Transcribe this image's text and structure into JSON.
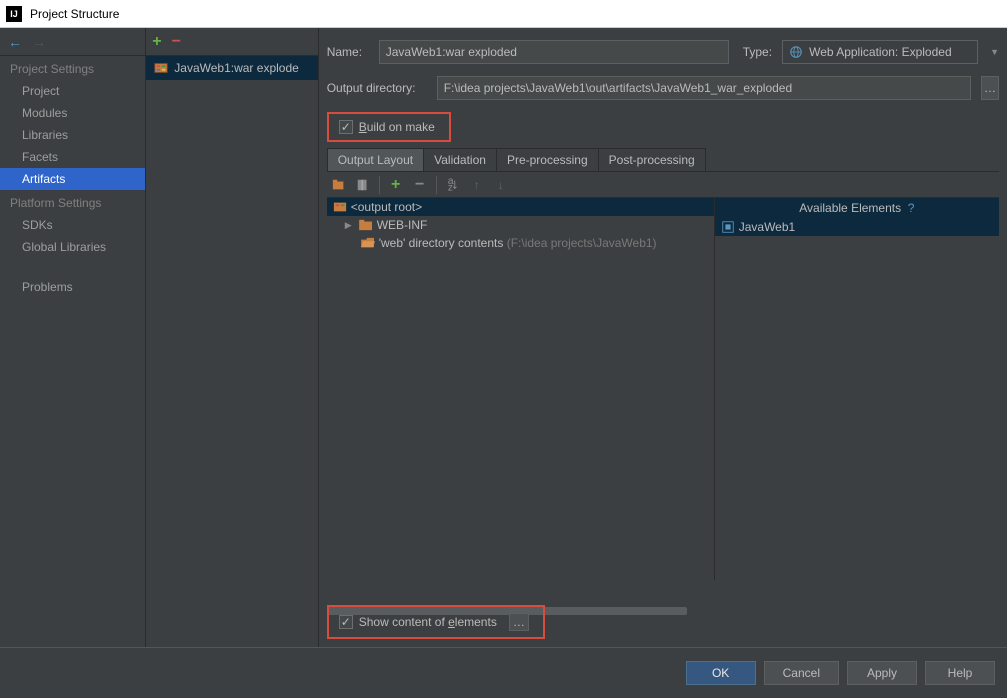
{
  "window": {
    "title": "Project Structure"
  },
  "sidebar": {
    "sections": [
      {
        "title": "Project Settings",
        "items": [
          {
            "label": "Project"
          },
          {
            "label": "Modules"
          },
          {
            "label": "Libraries"
          },
          {
            "label": "Facets"
          },
          {
            "label": "Artifacts",
            "selected": true
          }
        ]
      },
      {
        "title": "Platform Settings",
        "items": [
          {
            "label": "SDKs"
          },
          {
            "label": "Global Libraries"
          }
        ]
      },
      {
        "title": "",
        "items": [
          {
            "label": "Problems"
          }
        ]
      }
    ]
  },
  "artifacts_list": [
    {
      "label": "JavaWeb1:war explode"
    }
  ],
  "form": {
    "name_label": "Name:",
    "name_value": "JavaWeb1:war exploded",
    "type_label": "Type:",
    "type_value": "Web Application: Exploded",
    "output_dir_label": "Output directory:",
    "output_dir_value": "F:\\idea projects\\JavaWeb1\\out\\artifacts\\JavaWeb1_war_exploded",
    "build_on_make": "Build on make",
    "show_content": "Show content of elements"
  },
  "tabs": [
    {
      "label": "Output Layout",
      "active": true
    },
    {
      "label": "Validation"
    },
    {
      "label": "Pre-processing"
    },
    {
      "label": "Post-processing"
    }
  ],
  "layout_tree": {
    "root": "<output root>",
    "webinf": "WEB-INF",
    "webdir_prefix": "'web' directory contents ",
    "webdir_path": "(F:\\idea projects\\JavaWeb1)"
  },
  "available": {
    "header": "Available Elements",
    "help": "?",
    "module": "JavaWeb1"
  },
  "footer": {
    "ok": "OK",
    "cancel": "Cancel",
    "apply": "Apply",
    "help": "Help"
  },
  "icons": {
    "dots": "…",
    "dropdown": "▼",
    "check": "✓",
    "expand": "▶"
  }
}
